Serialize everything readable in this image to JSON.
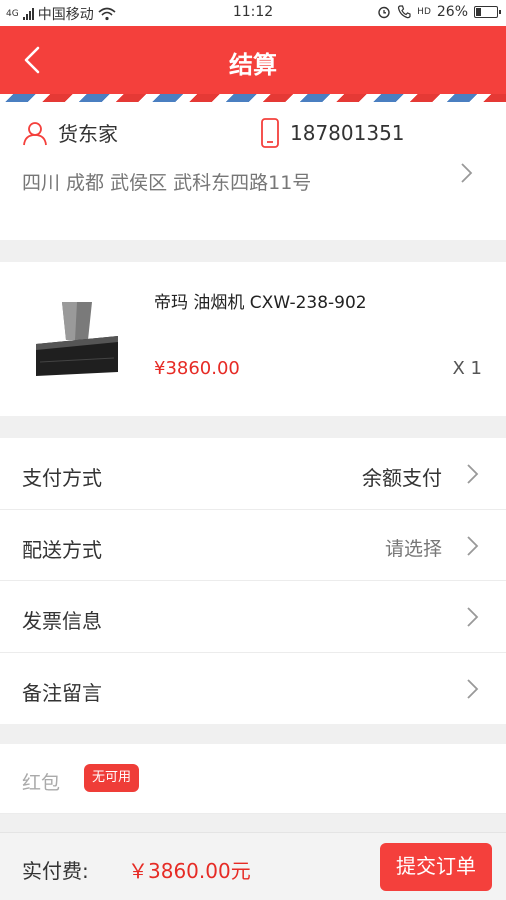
{
  "status_bar": {
    "carrier": "中国移动",
    "signal_label": "4G",
    "time": "11:12",
    "network_label": "HD",
    "battery": "26%",
    "battery_level": 0.26
  },
  "header": {
    "title": "结算",
    "back_icon": "chevron-left-icon",
    "background": "#f4403c"
  },
  "address": {
    "recipient": "货东家",
    "phone": "187801351",
    "full_address": "四川 成都 武侯区 武科东四路11号"
  },
  "product": {
    "name": "帝玛 油烟机 CXW-238-902",
    "price": "¥3860.00",
    "quantity": "X 1"
  },
  "options": [
    {
      "label": "支付方式",
      "value": "余额支付"
    },
    {
      "label": "配送方式",
      "value": "请选择"
    },
    {
      "label": "发票信息",
      "value": ""
    },
    {
      "label": "备注留言",
      "value": ""
    }
  ],
  "red_packet": {
    "label": "红包",
    "tag": "无可用"
  },
  "footer": {
    "pay_label": "实付费:",
    "amount": "￥3860.00元",
    "submit": "提交订单"
  },
  "colors": {
    "accent": "#f4403c",
    "price": "#e62b25"
  }
}
